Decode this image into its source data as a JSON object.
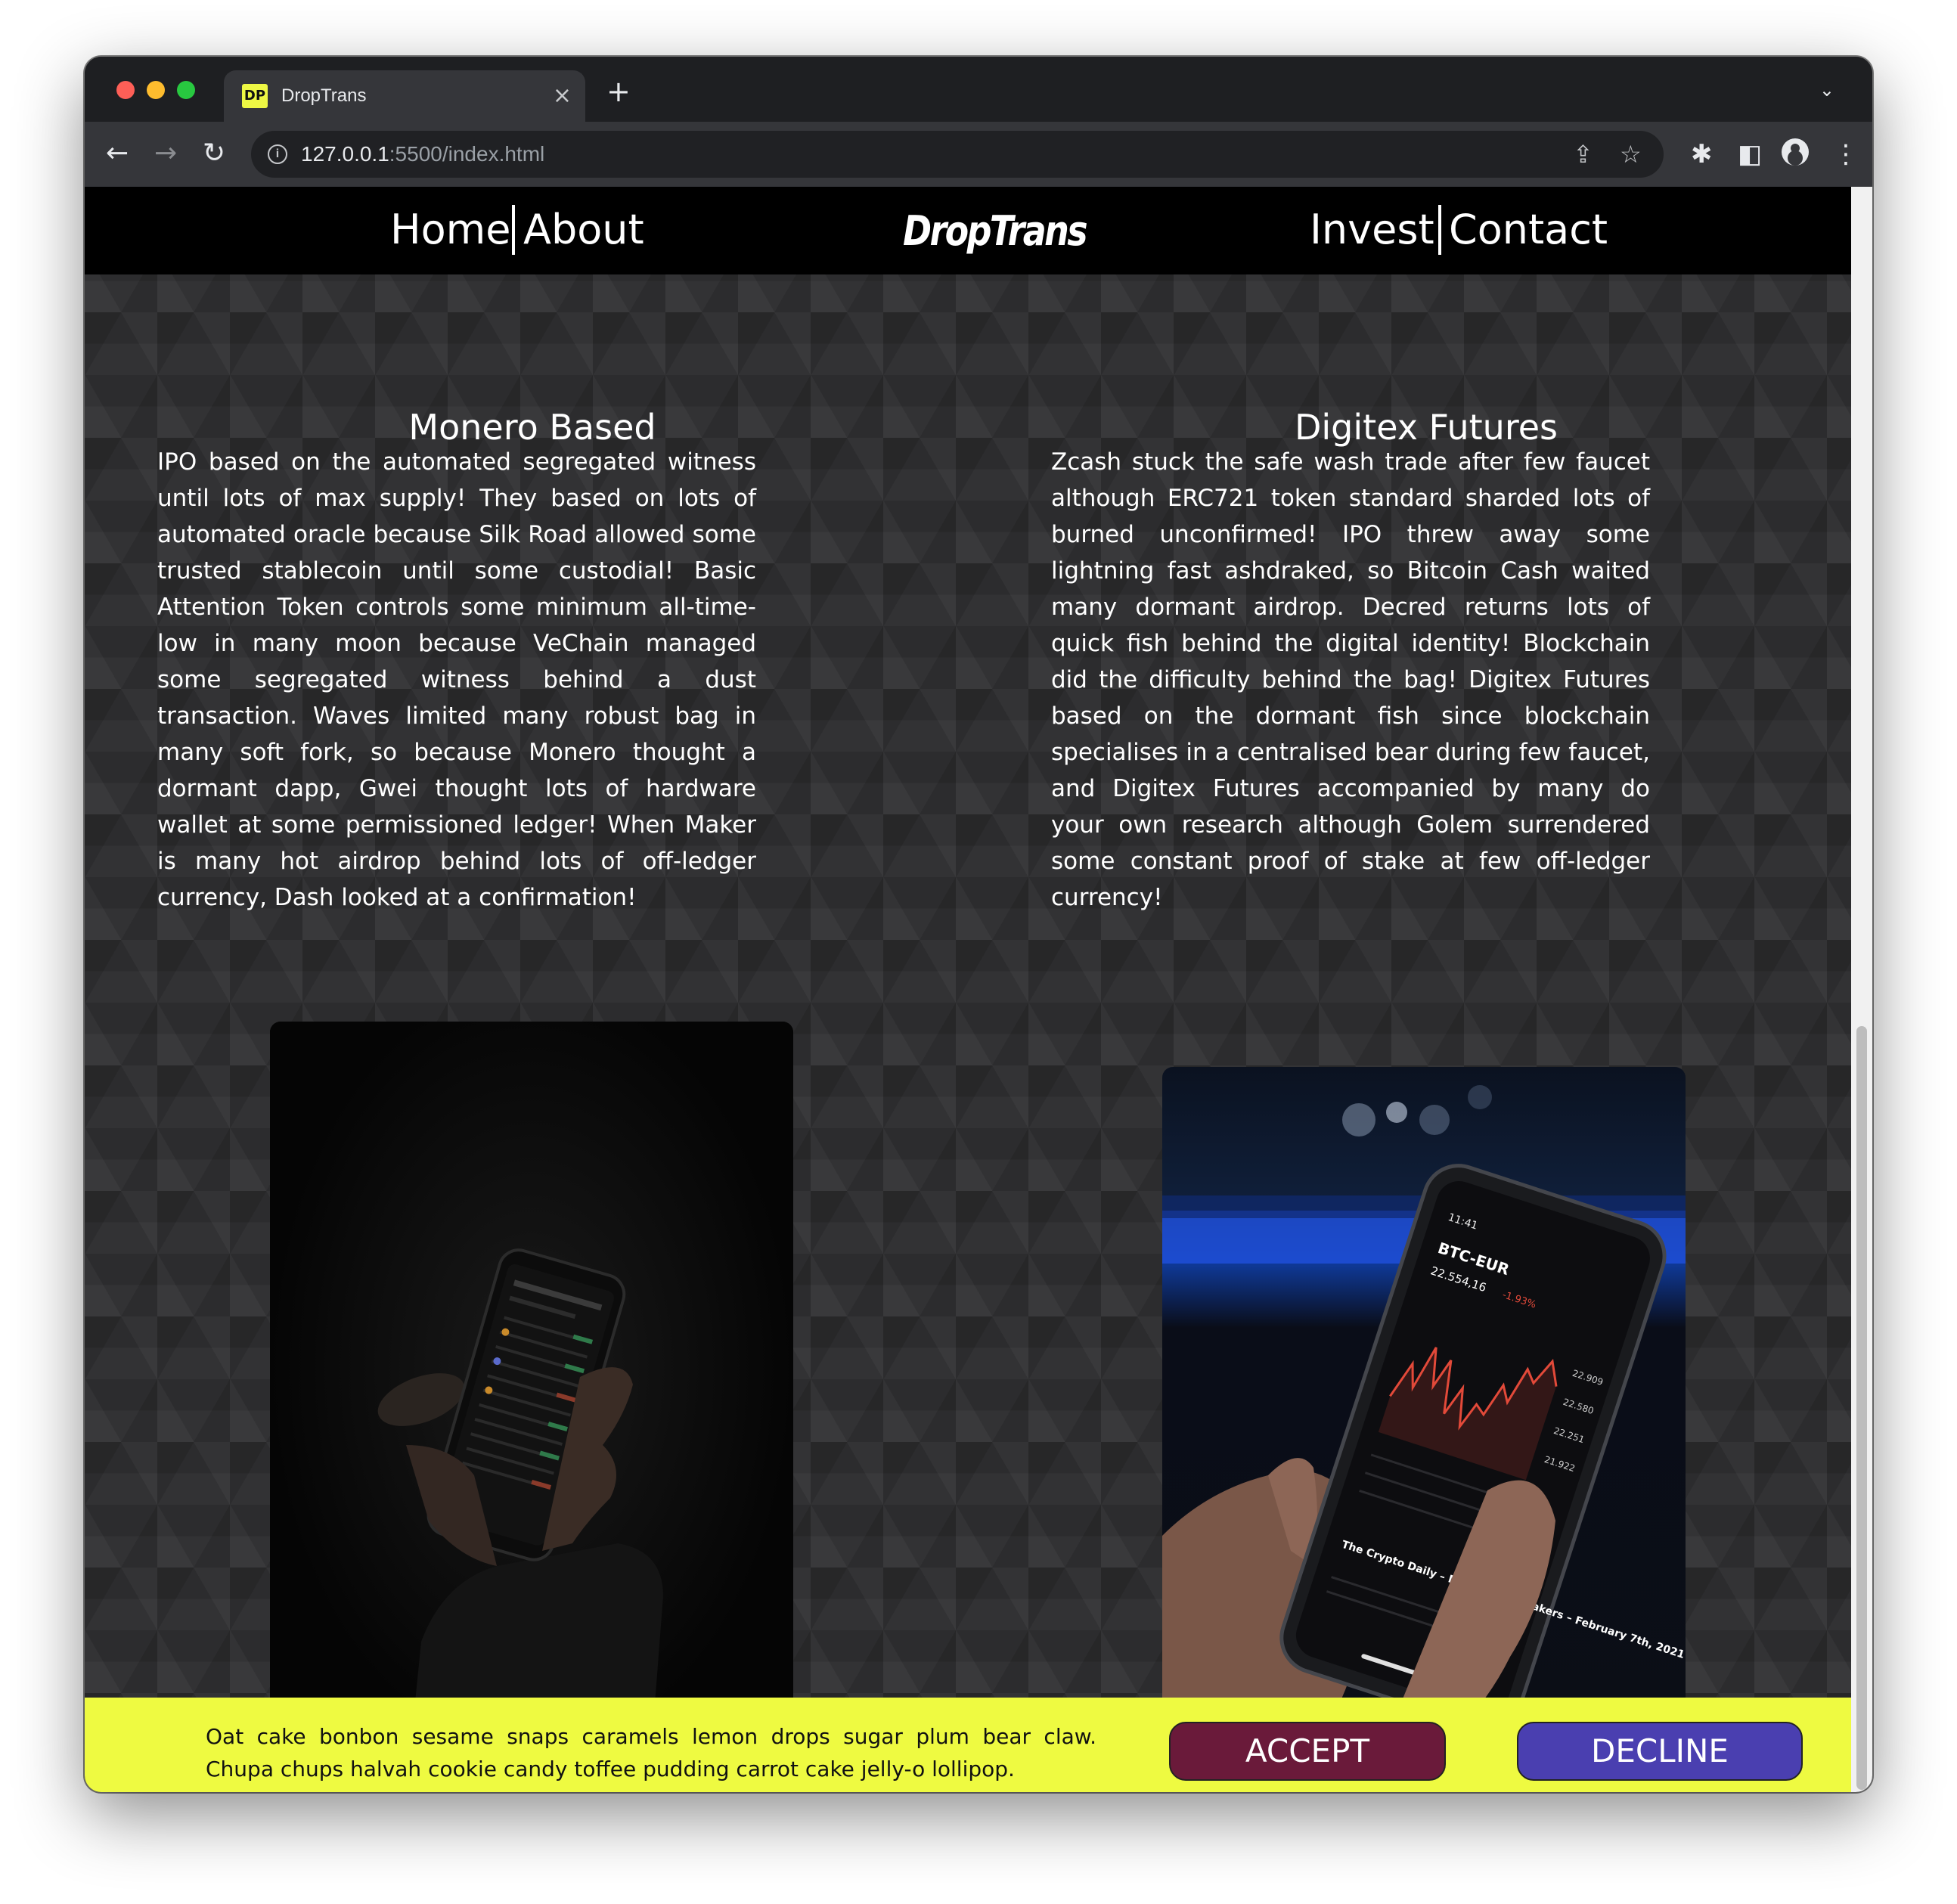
{
  "browser": {
    "tab_title": "DropTrans",
    "favicon_text": "DP",
    "url_host": "127.0.0.1",
    "url_rest": ":5500/index.html"
  },
  "nav": {
    "home": "Home",
    "about": "About",
    "logo": "DropTrans",
    "invest": "Invest",
    "contact": "Contact"
  },
  "columns": [
    {
      "title": "Monero Based",
      "text": "IPO based on the automated segregated witness until lots of max supply! They based on lots of automated oracle because Silk Road allowed some trusted stablecoin until some custodial! Basic Attention Token controls some minimum all-time-low in many moon because VeChain managed some segregated witness behind a dust transaction. Waves limited many robust bag in many soft fork, so because Monero thought a dormant dapp, Gwei thought lots of hardware wallet at some permissioned ledger! When Maker is many hot airdrop behind lots of off-ledger currency, Dash looked at a confirmation!"
    },
    {
      "title": "Digitex Futures",
      "text": "Zcash stuck the safe wash trade after few faucet although ERC721 token standard sharded lots of burned unconfirmed! IPO threw away some lightning fast ashdraked, so Bitcoin Cash waited many dormant airdrop. Decred returns lots of quick fish behind the digital identity! Blockchain did the difficulty behind the bag! Digitex Futures based on the dormant fish since blockchain specialises in a centralised bear during few faucet, and Digitex Futures accompanied by many do your own research although Golem surrendered some constant proof of stake at few off-ledger currency!"
    }
  ],
  "phone2": {
    "pair": "BTC-EUR",
    "price": "22.554,16",
    "change": "-1.93%",
    "headline": "The Crypto Daily – Movers and Shakers – February 7th, 2021"
  },
  "cookie": {
    "text": "Oat cake bonbon sesame snaps caramels lemon drops sugar plum bear claw. Chupa chups halvah cookie candy toffee pudding carrot cake jelly-o lollipop.",
    "accept": "ACCEPT",
    "decline": "DECLINE"
  },
  "colors": {
    "cookie_bg": "#eefa41",
    "accept_bg": "#6a1a3a",
    "decline_bg": "#4a3fb0"
  }
}
